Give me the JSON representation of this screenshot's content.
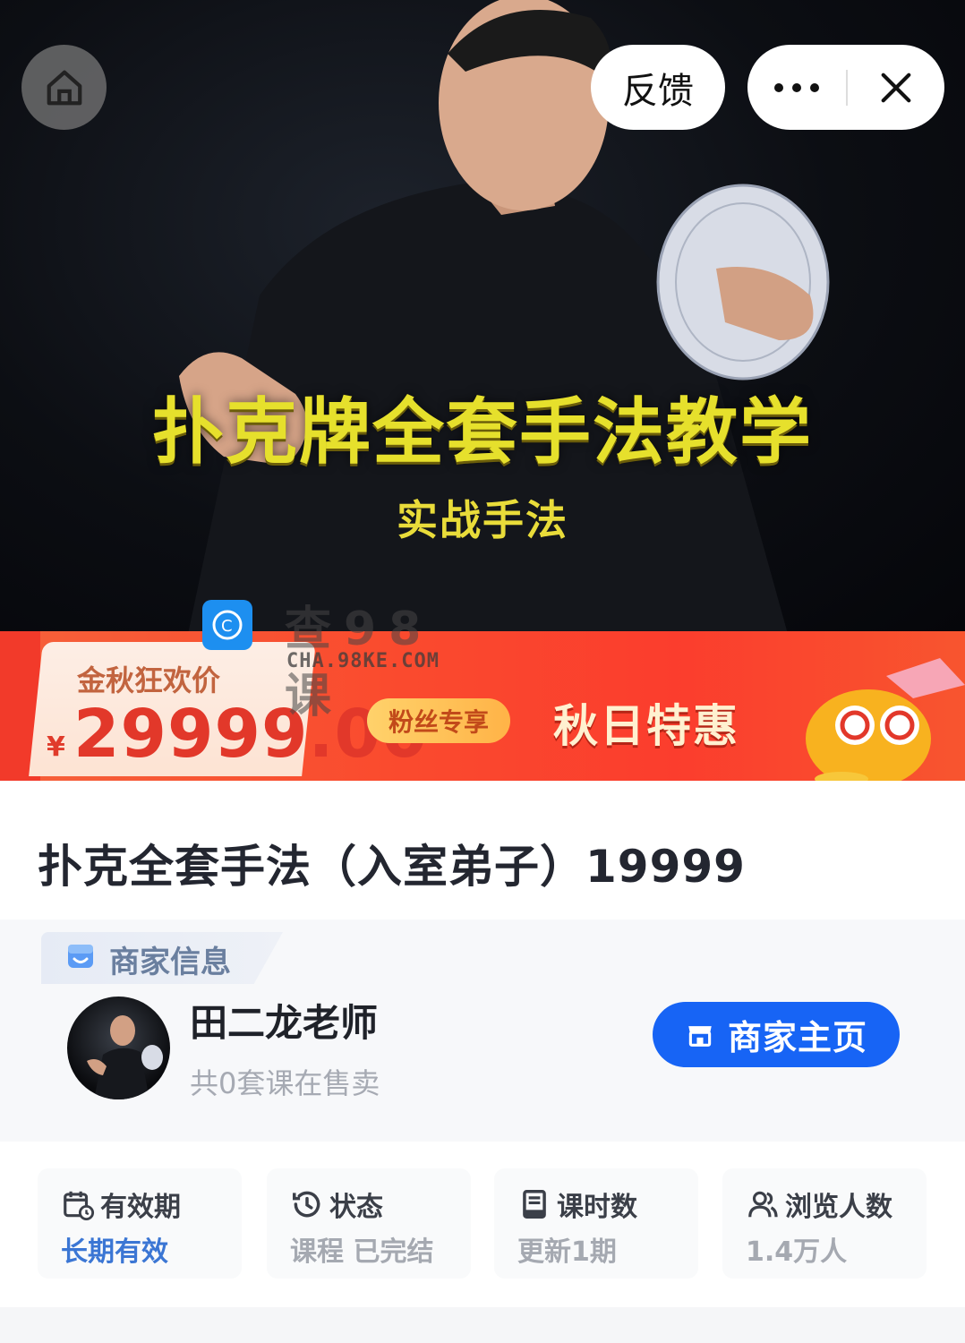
{
  "hero": {
    "title": "扑克牌全套手法教学",
    "subtitle": "实战手法"
  },
  "toolbar": {
    "feedback_label": "反馈"
  },
  "watermark": {
    "text": "查98课",
    "url": "CHA.98KE.COM"
  },
  "promo": {
    "label": "金秋狂欢价",
    "currency": "¥",
    "price": "29999.00",
    "tag": "粉丝专享",
    "title": "秋日特惠"
  },
  "course": {
    "title": "扑克全套手法（入室弟子）19999"
  },
  "merchant": {
    "section_label": "商家信息",
    "name": "田二龙老师",
    "course_count": "共0套课在售卖",
    "store_button": "商家主页"
  },
  "stats": [
    {
      "icon": "calendar-clock-icon",
      "label": "有效期",
      "value": "长期有效",
      "accent": true
    },
    {
      "icon": "history-icon",
      "label": "状态",
      "value": "课程 已完结",
      "accent": false
    },
    {
      "icon": "book-icon",
      "label": "课时数",
      "value": "更新1期",
      "accent": false
    },
    {
      "icon": "users-icon",
      "label": "浏览人数",
      "value": "1.4万人",
      "accent": false
    }
  ],
  "colors": {
    "brand_blue": "#1764f5",
    "promo_red": "#fb3d2d",
    "hero_yellow": "#e6e02c",
    "accent_value": "#3b76d4"
  }
}
